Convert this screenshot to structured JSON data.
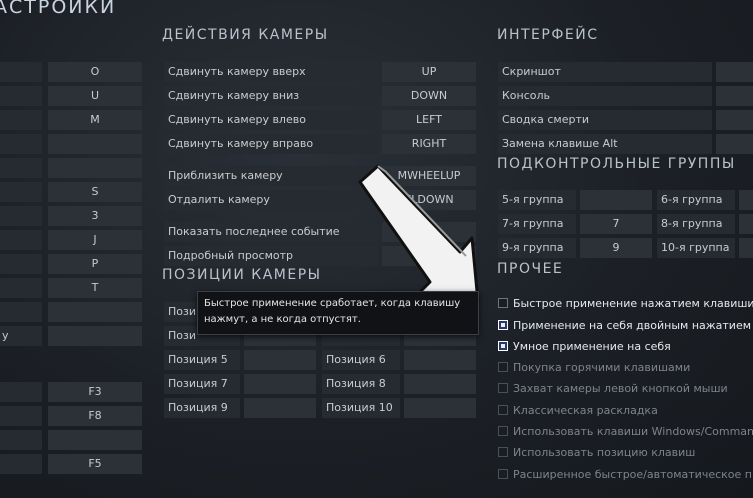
{
  "page_title": "АСТРОЙКИ",
  "left_keys": [
    "O",
    "U",
    "M",
    "",
    "",
    "S",
    "3",
    "J",
    "P",
    "T",
    "",
    "",
    "F3",
    "F8",
    "",
    "F5"
  ],
  "left_fragment": "y",
  "camera_actions": {
    "title": "ДЕЙСТВИЯ КАМЕРЫ",
    "rows": [
      {
        "label": "Сдвинуть камеру вверх",
        "key": "UP"
      },
      {
        "label": "Сдвинуть камеру вниз",
        "key": "DOWN"
      },
      {
        "label": "Сдвинуть камеру влево",
        "key": "LEFT"
      },
      {
        "label": "Сдвинуть камеру вправо",
        "key": "RIGHT"
      },
      {
        "label": "Приблизить камеру",
        "key": "MWHEELUP"
      },
      {
        "label": "Отдалить камеру",
        "key": "ELDOWN"
      },
      {
        "label": "Показать последнее событие",
        "key": ""
      },
      {
        "label": "Подробный просмотр",
        "key": ""
      }
    ]
  },
  "camera_positions": {
    "title": "ПОЗИЦИИ КАМЕРЫ",
    "left": [
      "Пози",
      "Пози",
      "Позиция 5",
      "Позиция 7",
      "Позиция 9"
    ],
    "right": [
      "",
      "",
      "Позиция 6",
      "Позиция 8",
      "Позиция 10"
    ]
  },
  "interface": {
    "title": "ИНТЕРФЕЙС",
    "rows": [
      "Скриншот",
      "Консоль",
      "Сводка смерти",
      "Замена клавише Alt"
    ]
  },
  "control_groups": {
    "title": "ПОДКОНТРОЛЬНЫЕ ГРУППЫ",
    "rows": [
      {
        "l": "5-я группа",
        "lk": "",
        "r": "6-я группа"
      },
      {
        "l": "7-я группа",
        "lk": "7",
        "r": "8-я группа"
      },
      {
        "l": "9-я группа",
        "lk": "9",
        "r": "10-я группа"
      }
    ]
  },
  "misc": {
    "title": "ПРОЧЕЕ",
    "options": [
      {
        "label": "Быстрое применение нажатием клавиши",
        "state": "unchecked"
      },
      {
        "label": "Применение на себя двойным нажатием",
        "state": "checked"
      },
      {
        "label": "Умное применение на себя",
        "state": "checked"
      },
      {
        "label": "Покупка горячими клавишами",
        "state": "disabled"
      },
      {
        "label": "Захват камеры левой кнопкой мыши",
        "state": "disabled"
      },
      {
        "label": "Классическая раскладка",
        "state": "disabled"
      },
      {
        "label": "Использовать клавиши Windows/Command",
        "state": "disabled"
      },
      {
        "label": "Использовать позицию клавиш",
        "state": "disabled"
      },
      {
        "label": "Расширенное быстрое/автоматическое прим",
        "state": "disabled"
      }
    ]
  },
  "tooltip": {
    "text": "Быстрое применение сработает, когда клавишу нажмут, а не когда отпустят."
  }
}
